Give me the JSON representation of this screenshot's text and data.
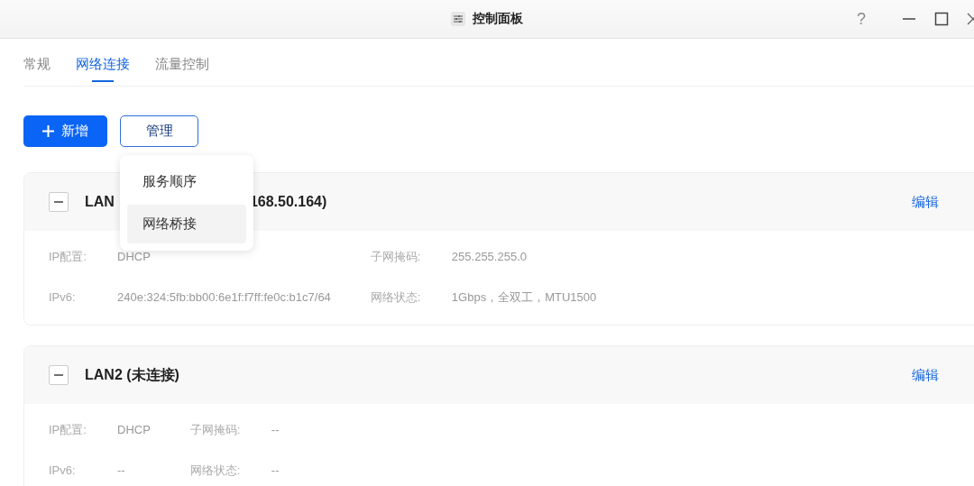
{
  "window": {
    "title": "控制面板",
    "help": "?"
  },
  "tabs": [
    {
      "label": "常规",
      "selected": false
    },
    {
      "label": "网络连接",
      "selected": true
    },
    {
      "label": "流量控制",
      "selected": false
    }
  ],
  "toolbar": {
    "add_button": "新增",
    "manage_button": "管理"
  },
  "manage_menu": [
    {
      "label": "服务顺序",
      "selected": false
    },
    {
      "label": "网络桥接",
      "selected": true
    }
  ],
  "interfaces": [
    {
      "title_parts": [
        "LAN",
        "168.50.164)"
      ],
      "expanded": true,
      "edit": "编辑",
      "fields": [
        {
          "label": "IP配置:",
          "value": "DHCP"
        },
        {
          "label": "子网掩码:",
          "value": "255.255.255.0"
        },
        {
          "label": "IPv6:",
          "value": "240e:324:5fb:bb00:6e1f:f7ff:fe0c:b1c7/64"
        },
        {
          "label": "网络状态:",
          "value": "1Gbps，全双工，MTU1500"
        }
      ]
    },
    {
      "title_parts": [
        "LAN2 (未连接)"
      ],
      "expanded": true,
      "edit": "编辑",
      "fields": [
        {
          "label": "IP配置:",
          "value": "DHCP"
        },
        {
          "label": "子网掩码:",
          "value": "--"
        },
        {
          "label": "IPv6:",
          "value": "--"
        },
        {
          "label": "网络状态:",
          "value": "--"
        }
      ]
    }
  ]
}
